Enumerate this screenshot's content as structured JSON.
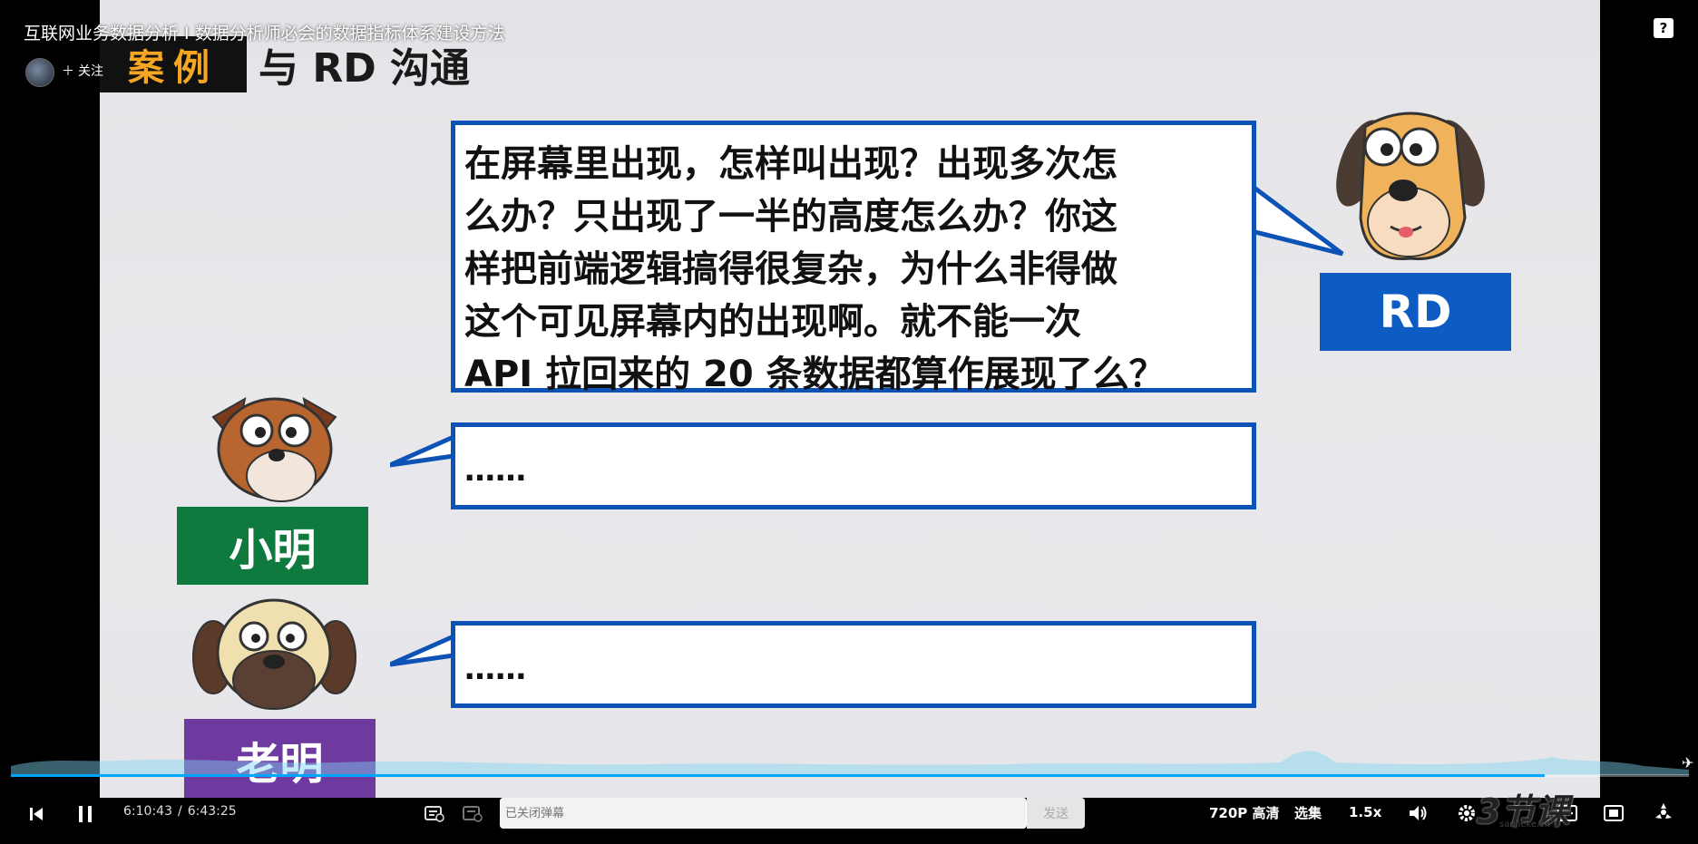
{
  "video": {
    "title": "互联网业务数据分析 I 数据分析师必会的数据指标体系建设方法",
    "follow_label": "关注",
    "slide": {
      "case_tag": "案例",
      "case_title": "与 RD 沟通",
      "rd_speech": [
        "在屏幕里出现，怎样叫出现？出现多次怎",
        "么办？只出现了一半的高度怎么办？你这",
        "样把前端逻辑搞得很复杂，为什么非得做",
        "这个可见屏幕内的出现啊。就不能一次",
        "API 拉回来的 20 条数据都算作展现了么？"
      ],
      "xiaoming_speech": "……",
      "laoming_speech": "……",
      "names": {
        "rd": "RD",
        "xiaoming": "小明",
        "laoming": "老明"
      }
    }
  },
  "player": {
    "current_time": "6:10:43",
    "separator": "/",
    "duration": "6:43:25",
    "progress": 0.914,
    "danmaku_placeholder": "已关闭弹幕",
    "send_label": "发送",
    "quality_label": "720P 高清",
    "episodes_label": "选集",
    "speed_label": "1.5x",
    "watermark": "3节课",
    "watermark_url": "sanjieke.cn",
    "accent_color": "#00a6ff"
  }
}
